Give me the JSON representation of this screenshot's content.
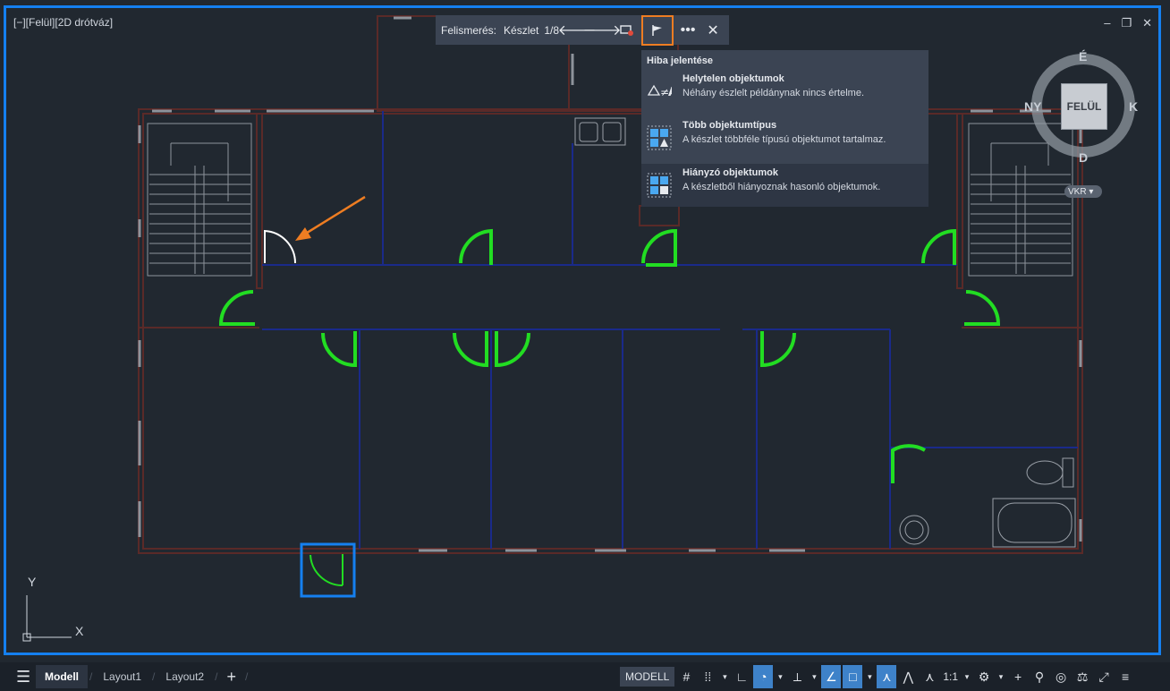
{
  "viewport": {
    "label": "[−][Felül][2D drótváz]",
    "controls": [
      "–",
      "❐",
      "✕"
    ]
  },
  "detection": {
    "label": "Felismerés:",
    "set_label": "Készlet",
    "count": "1/8"
  },
  "report": {
    "title": "Hiba jelentése",
    "items": [
      {
        "title": "Helytelen objektumok",
        "desc": "Néhány észlelt példánynak nincs értelme.",
        "icon": "triangle-not-equal-a-icon"
      },
      {
        "title": "Több objektumtípus",
        "desc": "A készlet többféle típusú objektumot tartalmaz.",
        "icon": "mixed-types-icon"
      },
      {
        "title": "Hiányzó objektumok",
        "desc": "A készletből hiányoznak hasonló objektumok.",
        "icon": "missing-objects-icon"
      }
    ]
  },
  "navcube": {
    "north": "É",
    "south": "D",
    "east": "K",
    "west": "NY",
    "face": "FELÜL",
    "ucs": "VKR"
  },
  "ucs_icon": {
    "x": "X",
    "y": "Y"
  },
  "statusbar": {
    "tabs": [
      "Modell",
      "Layout1",
      "Layout2"
    ],
    "active_tab": "Modell",
    "modell_button": "MODELL",
    "scale": "1:1"
  },
  "colors": {
    "accent_blue": "#1580f0",
    "highlight_orange": "#ee7d22",
    "door_green": "#22dd22",
    "wall_blue": "#1a2a8a",
    "wall_brown": "#5a2a28"
  }
}
